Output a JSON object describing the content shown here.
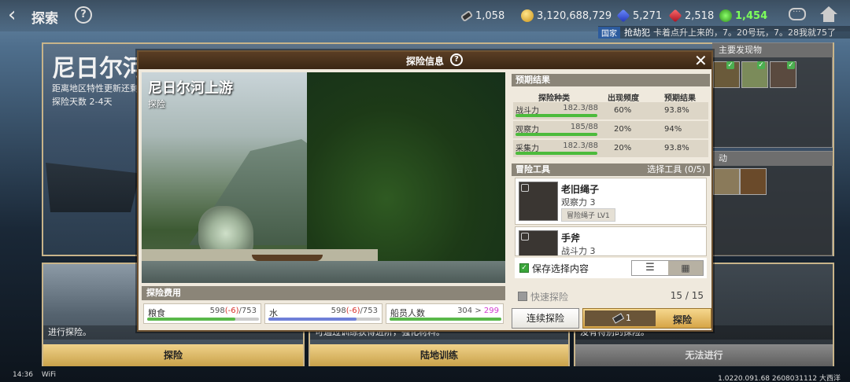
{
  "topbar": {
    "back_label": "‹",
    "title": "探索",
    "help": "?",
    "resources": [
      {
        "icon": "ticket-icon",
        "value": "1,058"
      },
      {
        "icon": "gold-coin-icon",
        "value": "3,120,688,729"
      },
      {
        "icon": "blue-gem-icon",
        "value": "5,271"
      },
      {
        "icon": "red-gem-icon",
        "value": "2,518"
      },
      {
        "icon": "green-gear-icon",
        "value": "1,454"
      }
    ],
    "chat": {
      "channel": "国家",
      "sender": "抢劫犯",
      "message": "卡着点升上来的，7。20号玩，7。28我就75了"
    }
  },
  "background": {
    "region_title": "尼日尔河",
    "region_sub1": "距离地区特性更新还剩",
    "region_sub2": "探险天数 2-4天",
    "panel1_label": "主要发现物",
    "panel2_label": "动",
    "card1_text": "进行探险。",
    "card2_text": "可通过训练获得进阶，强化材料。",
    "card3_text": "没有特别的探险。",
    "btn_explore": "探险",
    "btn_training": "陆地训练",
    "btn_unavailable": "无法进行"
  },
  "status_bar": {
    "time": "14:36",
    "wifi": "WiFi",
    "version": "1.0220.091.68 2608031112 大西洋"
  },
  "modal": {
    "title": "探险信息",
    "help": "?",
    "close": "✕",
    "location_name": "尼日尔河上游",
    "location_type": "探险",
    "cost_header": "探险费用",
    "costs": [
      {
        "label": "粮食",
        "current": "598",
        "delta": "(-6)",
        "max": "/753",
        "fill": 0.79,
        "color": "#5ab84a"
      },
      {
        "label": "水",
        "current": "598",
        "delta": "(-6)",
        "max": "/753",
        "fill": 0.79,
        "color": "#6f7fd8"
      },
      {
        "label": "船员人数",
        "current": "304",
        "arrow": " > ",
        "after": "299",
        "fill": 1.0,
        "color": "#5ab84a"
      }
    ],
    "prediction_header": "预期结果",
    "pred_columns": [
      "探险种类",
      "出现频度",
      "预期结果"
    ],
    "predictions": [
      {
        "type": "战斗力",
        "score": "182.3/88",
        "freq": "60%",
        "result": "93.8%"
      },
      {
        "type": "观察力",
        "score": "185/88",
        "freq": "20%",
        "result": "94%"
      },
      {
        "type": "采集力",
        "score": "182.3/88",
        "freq": "20%",
        "result": "93.8%"
      }
    ],
    "tools_header": "冒险工具",
    "tools_select": "选择工具 (0/5)",
    "tools": [
      {
        "name": "老旧绳子",
        "stat": "观察力 3",
        "tag": "冒险绳子 LV1"
      },
      {
        "name": "手斧",
        "stat": "战斗力 3"
      }
    ],
    "save_label": "保存选择内容",
    "quick_label": "快速探险",
    "quick_count": "15 / 15",
    "continuous_label": "连续探险",
    "explore_cost": "1",
    "explore_label": "探险"
  }
}
